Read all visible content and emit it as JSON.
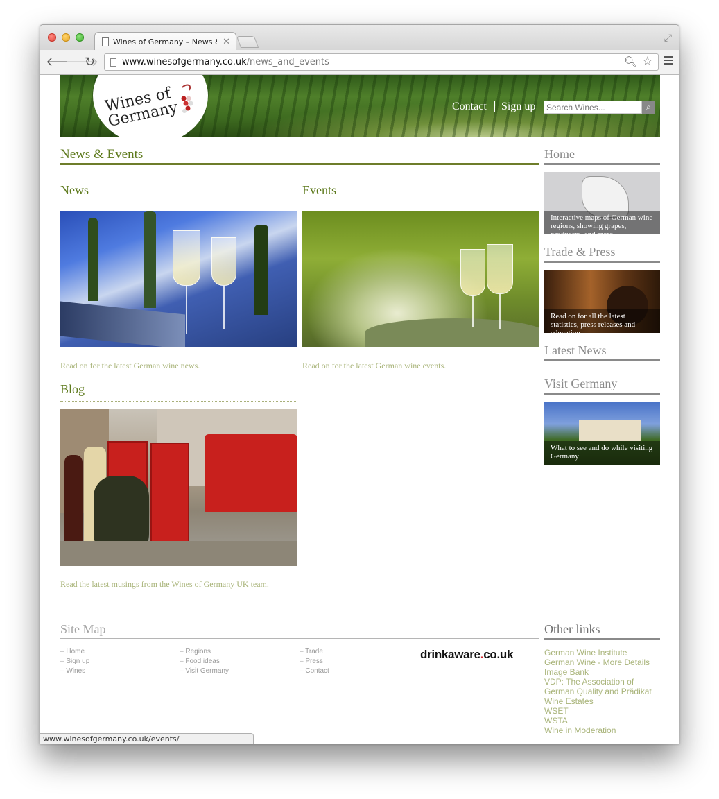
{
  "browser": {
    "tab_title": "Wines of Germany – News &",
    "url_host": "www.winesofgermany.co.uk",
    "url_path": "/news_and_events",
    "status_url": "www.winesofgermany.co.uk/events/"
  },
  "header": {
    "logo_line1": "Wines of",
    "logo_line2": "Germany",
    "contact": "Contact",
    "signup": "Sign up",
    "search_placeholder": "Search Wines..."
  },
  "main": {
    "title": "News & Events",
    "news": {
      "title": "News",
      "teaser": "Read on for the latest German wine news."
    },
    "events": {
      "title": "Events",
      "teaser": "Read on for the latest German wine events."
    },
    "blog": {
      "title": "Blog",
      "teaser": "Read the latest musings from the Wines of Germany UK team."
    }
  },
  "sidebar": {
    "home": {
      "title": "Home",
      "caption": "Interactive maps of German wine regions, showing grapes, producers, and more"
    },
    "trade": {
      "title": "Trade & Press",
      "caption": "Read on for all the latest statistics, press releases and education"
    },
    "latest": {
      "title": "Latest News"
    },
    "visit": {
      "title": "Visit Germany",
      "caption": "What to see and do while visiting Germany"
    }
  },
  "footer": {
    "sitemap_title": "Site Map",
    "sitemap_links": [
      [
        "Home",
        "Sign up",
        "Wines"
      ],
      [
        "Regions",
        "Food ideas",
        "Visit Germany"
      ],
      [
        "Trade",
        "Press",
        "Contact"
      ]
    ],
    "drinkaware_1": "drinkaware",
    "drinkaware_dot": ".",
    "drinkaware_2": "co.uk",
    "other_title": "Other links",
    "other_links": [
      "German Wine Institute",
      "German Wine - More Details",
      "Image Bank",
      "VDP: The Association of German Quality and Prädikat Wine Estates",
      "WSET",
      "WSTA",
      "Wine in Moderation"
    ]
  }
}
